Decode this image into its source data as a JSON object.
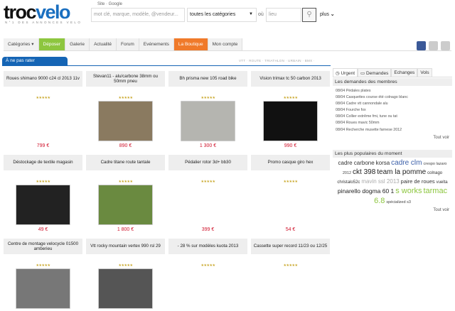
{
  "header": {
    "logo_a": "troc",
    "logo_b": "velo",
    "tagline": "N°1 DES ANNONCES VELO",
    "sources": "Site · Google",
    "search_placeholder": "mot clé, marque, modèle, @vendeur...",
    "category": "toutes les catégories",
    "ou": "où",
    "place_placeholder": "lieu",
    "plus": "plus"
  },
  "nav": [
    {
      "label": "Catégories ▾"
    },
    {
      "label": "Déposer"
    },
    {
      "label": "Galerie"
    },
    {
      "label": "Actualité"
    },
    {
      "label": "Forum"
    },
    {
      "label": "Evénements"
    },
    {
      "label": "La Boutique"
    },
    {
      "label": "Mon compte"
    }
  ],
  "banner": "À ne pas rater",
  "filters": "VTT · ROUTE · TRIATHLON · URBAIN · BMX ·",
  "listings": [
    {
      "title": "Roues shimano 9000 c24 cl 2013 11v",
      "price": "799 €",
      "color": "#fff"
    },
    {
      "title": "Stevan11 - alu/carbone 38mm ou 50mm pneu",
      "price": "890 €",
      "color": "#8a7a60"
    },
    {
      "title": "Bh prisma new 105 road bike",
      "price": "1 300 €",
      "color": "#b5b5b0"
    },
    {
      "title": "Vision trimax tc 50 carbon 2013",
      "price": "990 €",
      "color": "#111"
    },
    {
      "title": "Déstockage de textile magasin",
      "price": "49 €",
      "color": "#222"
    },
    {
      "title": "Cadre titane route tantale",
      "price": "1 800 €",
      "color": "#6a8a40"
    },
    {
      "title": "Pédalier rotor 3d+ bb30",
      "price": "399 €",
      "color": "#fff"
    },
    {
      "title": "Promo casque giro hex",
      "price": "54 €",
      "color": "#fff"
    },
    {
      "title": "Centre de montage velocycle 01500 amberieu",
      "price": "",
      "color": "#777"
    },
    {
      "title": "Vtt rocky mountain vertex 990 rsl 29",
      "price": "",
      "color": "#555"
    },
    {
      "title": "- 28 % sur modèles kuota 2013",
      "price": "",
      "color": "#fff"
    },
    {
      "title": "Cassette super record 11/23 ou 12/25",
      "price": "",
      "color": "#fff"
    }
  ],
  "stars": "★★★★★",
  "sidebar": {
    "tabs": [
      "Urgent",
      "Demandes",
      "Echanges",
      "Vols"
    ],
    "requests_title": "Les demandes des membres",
    "requests": [
      "08/04 Pédales plates",
      "08/04 Casquettes course été colnago blanc",
      "08/04 Cadre vtt cannondale alu",
      "08/04 Fourche fox",
      "08/04 Collier extrême  fmi, tune ou tat",
      "08/04 Roues mavic 50mm",
      "08/04 Recherche musette farnese 2012"
    ],
    "see_all": "Tout voir",
    "popular_title": "Les plus populaires du moment",
    "tags": [
      {
        "t": "cadre carbone",
        "s": 8,
        "c": "#333"
      },
      {
        "t": "korsa",
        "s": 8,
        "c": "#333"
      },
      {
        "t": "cadre clm",
        "s": 10,
        "c": "#3b5fa8"
      },
      {
        "t": "crespo lazaro",
        "s": 5.5,
        "c": "#444"
      },
      {
        "t": "2012",
        "s": 5.5,
        "c": "#444"
      },
      {
        "t": "ckt 398",
        "s": 10,
        "c": "#222"
      },
      {
        "t": "team la pomme",
        "s": 10,
        "c": "#222"
      },
      {
        "t": "colnago",
        "s": 6,
        "c": "#333"
      },
      {
        "t": "christalo52c",
        "s": 6,
        "c": "#333"
      },
      {
        "t": "mavin ssl 2013",
        "s": 8,
        "c": "#aaa"
      },
      {
        "t": "paire de roues",
        "s": 7.5,
        "c": "#333"
      },
      {
        "t": "vuelta",
        "s": 6,
        "c": "#333"
      },
      {
        "t": "pinarello dogma 60 1",
        "s": 8.5,
        "c": "#222"
      },
      {
        "t": "s works",
        "s": 11,
        "c": "#8dc63f"
      },
      {
        "t": "tarmac 6.8",
        "s": 11,
        "c": "#8dc63f"
      },
      {
        "t": "spécialized s3",
        "s": 5.5,
        "c": "#444"
      }
    ],
    "see_all_2": "Tout voir"
  }
}
